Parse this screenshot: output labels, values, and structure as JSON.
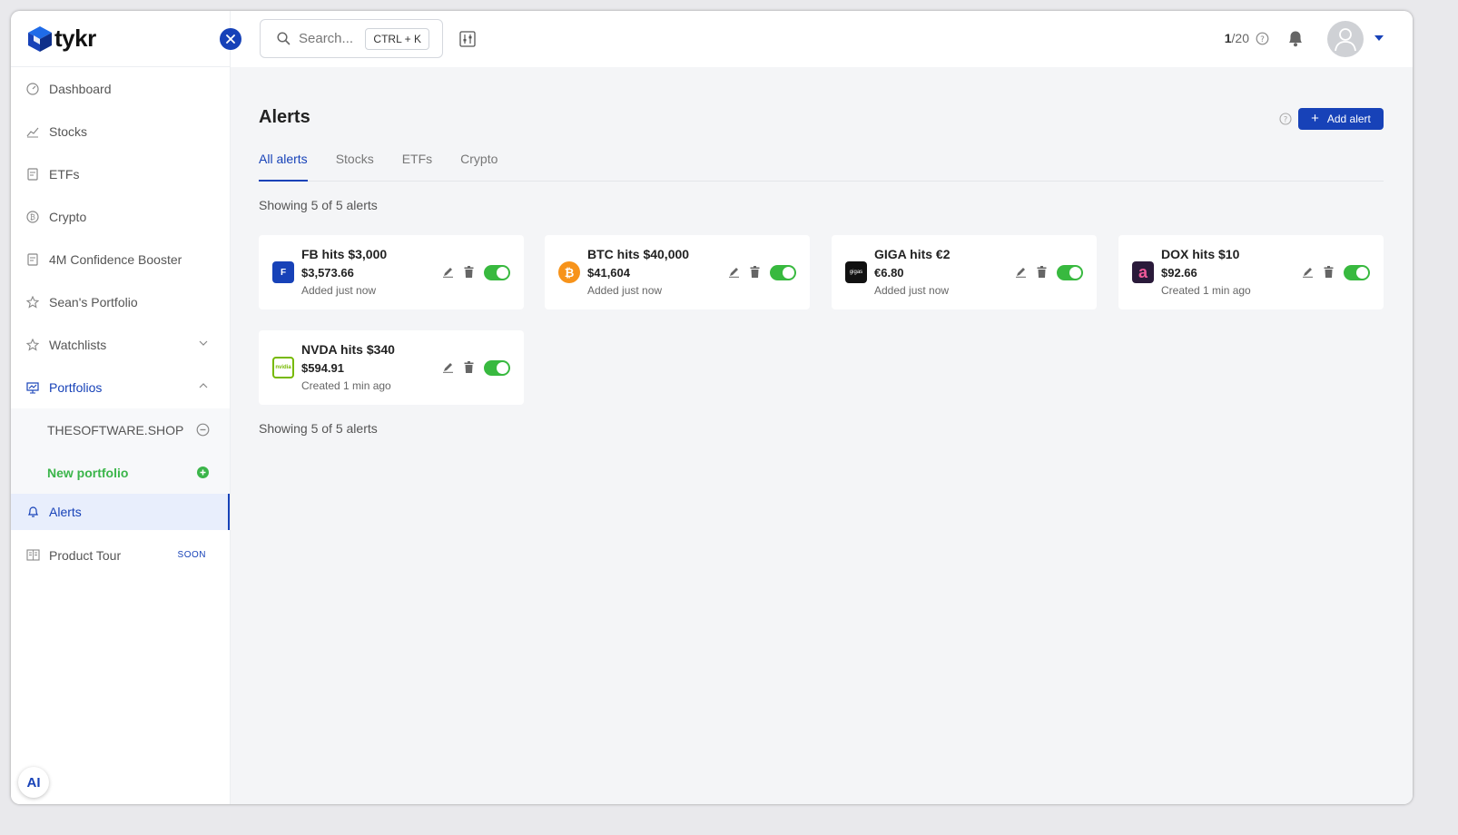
{
  "app": {
    "name": "tykr"
  },
  "search": {
    "placeholder": "Search...",
    "shortcut": "CTRL + K"
  },
  "topbar": {
    "quota_used": "1",
    "quota_total": "/20"
  },
  "sidebar": {
    "items": [
      {
        "label": "Dashboard",
        "icon": "dashboard-icon"
      },
      {
        "label": "Stocks",
        "icon": "chart-icon"
      },
      {
        "label": "ETFs",
        "icon": "document-icon"
      },
      {
        "label": "Crypto",
        "icon": "bitcoin-icon"
      },
      {
        "label": "4M Confidence Booster",
        "icon": "document-icon"
      },
      {
        "label": "Sean's Portfolio",
        "icon": "star-icon"
      },
      {
        "label": "Watchlists",
        "icon": "star-icon"
      },
      {
        "label": "Portfolios",
        "icon": "presentation-icon"
      }
    ],
    "portfolios": [
      {
        "label": "THESOFTWARE.SHOP"
      },
      {
        "label": "New portfolio"
      }
    ],
    "alerts_label": "Alerts",
    "product_tour_label": "Product Tour",
    "soon_label": "SOON",
    "ai_label": "AI"
  },
  "main": {
    "title": "Alerts",
    "add_alert_label": "Add alert",
    "tabs": [
      "All alerts",
      "Stocks",
      "ETFs",
      "Crypto"
    ],
    "active_tab": "All alerts",
    "showing_text": "Showing 5 of 5 alerts",
    "alerts": [
      {
        "title": "FB hits $3,000",
        "price": "$3,573.66",
        "sub": "Added just now",
        "logo_text": "F",
        "logo_color": "#1742b8",
        "enabled": true
      },
      {
        "title": "BTC hits $40,000",
        "price": "$41,604",
        "sub": "Added just now",
        "logo_text": "₿",
        "logo_color": "#f7931a",
        "enabled": true
      },
      {
        "title": "GIGA hits €2",
        "price": "€6.80",
        "sub": "Added just now",
        "logo_text": "gigas",
        "logo_color": "#111111",
        "enabled": true
      },
      {
        "title": "DOX hits $10",
        "price": "$92.66",
        "sub": "Created 1 min ago",
        "logo_text": "a",
        "logo_color": "#2a1a3a",
        "enabled": true
      },
      {
        "title": "NVDA hits $340",
        "price": "$594.91",
        "sub": "Created 1 min ago",
        "logo_text": "nvidia",
        "logo_color": "#76b900",
        "enabled": true
      }
    ]
  },
  "colors": {
    "accent": "#1742b8",
    "toggle_on": "#38b93f",
    "new_portfolio": "#3bb54a"
  }
}
